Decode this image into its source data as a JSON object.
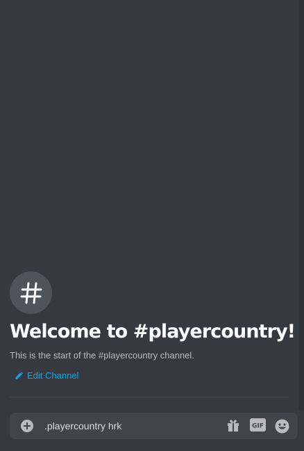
{
  "channel": {
    "icon": "hash-icon",
    "welcome_title": "Welcome to #playercountry!",
    "start_text": "This is the start of the #playercountry channel.",
    "edit_channel_label": "Edit Channel"
  },
  "composer": {
    "message_value": ".playercountry hrk",
    "gif_label": "GIF",
    "icons": [
      "plus-circle-icon",
      "gift-icon",
      "gif-icon",
      "emoji-icon"
    ]
  },
  "colors": {
    "background": "#36393f",
    "composer_background": "#40444b",
    "link": "#00b0f4",
    "icon_gray": "#b9bbbe",
    "title": "#ffffff"
  }
}
